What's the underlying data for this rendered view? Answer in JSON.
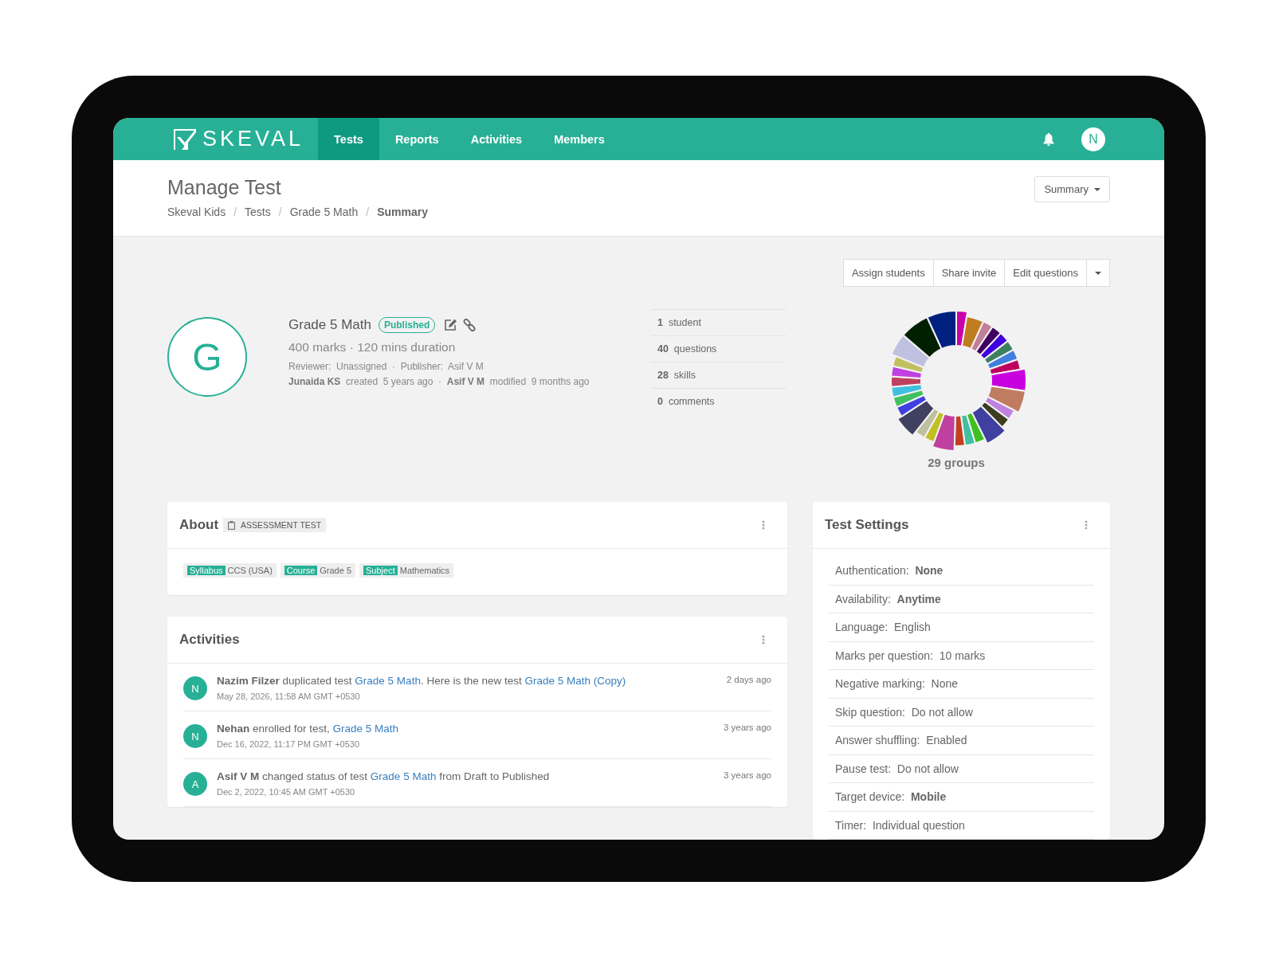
{
  "navbar": {
    "brand": "SKEVAL",
    "tabs": [
      {
        "label": "Tests",
        "selected": true
      },
      {
        "label": "Reports",
        "selected": false
      },
      {
        "label": "Activities",
        "selected": false
      },
      {
        "label": "Members",
        "selected": false
      }
    ],
    "avatar": "N"
  },
  "header": {
    "title": "Manage Test",
    "breadcrumb": [
      {
        "label": "Skeval Kids",
        "current": false
      },
      {
        "label": "Tests",
        "current": false
      },
      {
        "label": "Grade 5 Math",
        "current": false
      },
      {
        "label": "Summary",
        "current": true
      }
    ],
    "separator": "/",
    "view_menu": "Summary"
  },
  "actions": [
    "Assign students",
    "Share invite",
    "Edit questions"
  ],
  "test": {
    "initial": "G",
    "name": "Grade 5 Math",
    "status": "Published",
    "summary": "400 marks · 120 mins duration",
    "roles": "Reviewer:  Unassigned  ·  Publisher:  Asif V M",
    "history": "**Junaida KS**  created  5 years ago  ·  **Asif V M**  modified  9 months ago"
  },
  "stats": [
    {
      "count": "1",
      "label": "student"
    },
    {
      "count": "40",
      "label": "questions"
    },
    {
      "count": "28",
      "label": "skills"
    },
    {
      "count": "0",
      "label": "comments"
    }
  ],
  "groups_chart": {
    "caption": "29 groups"
  },
  "about": {
    "title": "About",
    "type": "ASSESSMENT TEST",
    "tags": [
      {
        "key": "Syllabus",
        "value": "CCS (USA)"
      },
      {
        "key": "Course",
        "value": "Grade 5"
      },
      {
        "key": "Subject",
        "value": "Mathematics"
      }
    ]
  },
  "activities": {
    "title": "Activities",
    "items": [
      {
        "avatar": "N",
        "time": "2 days ago",
        "date": "May 28, 2026, 11:58 AM GMT +0530",
        "parts": [
          {
            "kind": "actor",
            "text": "Nazim Filzer"
          },
          {
            "kind": "text",
            "text": " duplicated test "
          },
          {
            "kind": "link",
            "text": "Grade 5 Math"
          },
          {
            "kind": "text",
            "text": ". Here is the new test "
          },
          {
            "kind": "link",
            "text": "Grade 5 Math (Copy)"
          }
        ]
      },
      {
        "avatar": "N",
        "time": "3 years ago",
        "date": "Dec 16, 2022, 11:17 PM GMT +0530",
        "parts": [
          {
            "kind": "actor",
            "text": "Nehan"
          },
          {
            "kind": "text",
            "text": " enrolled for test, "
          },
          {
            "kind": "link",
            "text": "Grade 5 Math"
          }
        ]
      },
      {
        "avatar": "A",
        "time": "3 years ago",
        "date": "Dec 2, 2022, 10:45 AM GMT +0530",
        "parts": [
          {
            "kind": "actor",
            "text": "Asif V M"
          },
          {
            "kind": "text",
            "text": " changed status of test "
          },
          {
            "kind": "link",
            "text": "Grade 5 Math"
          },
          {
            "kind": "text",
            "text": " from Draft to Published"
          }
        ]
      }
    ]
  },
  "settings": {
    "title": "Test Settings",
    "items": [
      {
        "label": "Authentication:",
        "value": "None",
        "emphasis": true
      },
      {
        "label": "Availability:",
        "value": "Anytime",
        "emphasis": true
      },
      {
        "label": "Language:",
        "value": "English",
        "emphasis": false
      },
      {
        "label": "Marks per question:",
        "value": "10 marks",
        "emphasis": false
      },
      {
        "label": "Negative marking:",
        "value": "None",
        "emphasis": false
      },
      {
        "label": "Skip question:",
        "value": "Do not allow",
        "emphasis": false
      },
      {
        "label": "Answer shuffling:",
        "value": "Enabled",
        "emphasis": false
      },
      {
        "label": "Pause test:",
        "value": "Do not allow",
        "emphasis": false
      },
      {
        "label": "Target device:",
        "value": "Mobile",
        "emphasis": true
      },
      {
        "label": "Timer:",
        "value": "Individual question",
        "emphasis": false
      }
    ]
  }
}
